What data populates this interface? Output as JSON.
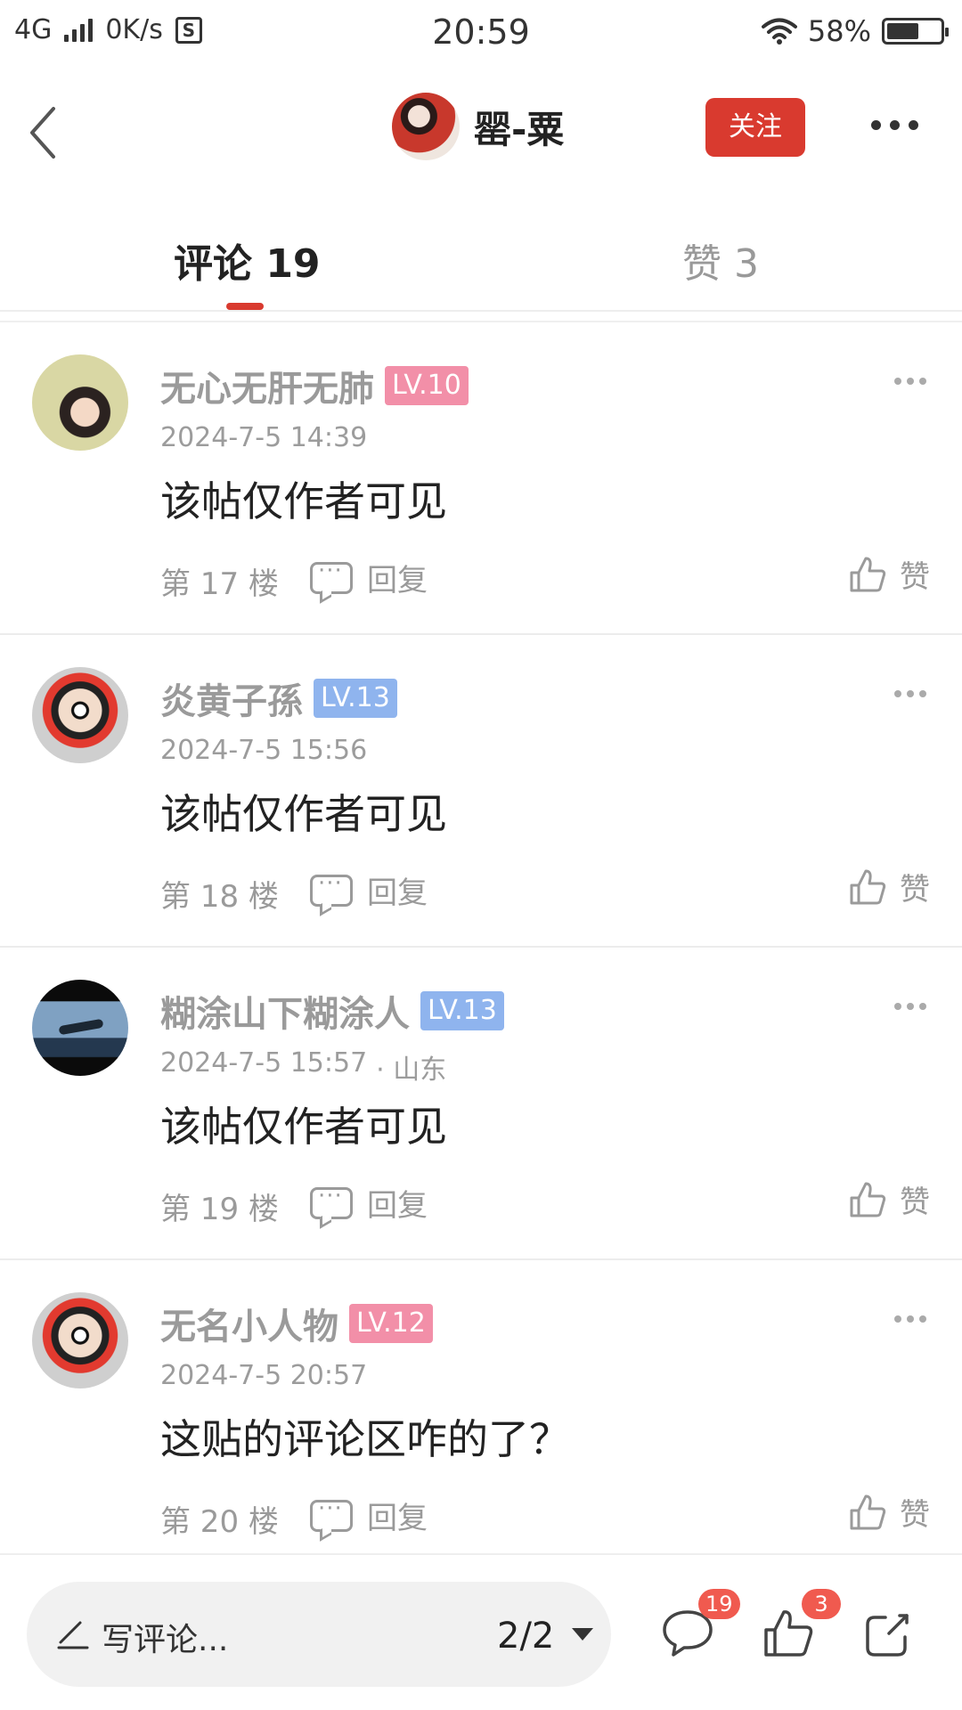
{
  "status_bar": {
    "network": "4G",
    "speed": "0K/s",
    "s_icon": "S",
    "time": "20:59",
    "battery": "58%"
  },
  "header": {
    "author_name": "罂-粟",
    "follow_label": "关注"
  },
  "tabs": {
    "comments": "评论 19",
    "likes": "赞 3"
  },
  "comments": [
    {
      "name": "无心无肝无肺",
      "level": "LV.10",
      "level_color": "#f28fa8",
      "time": "2024-7-5 14:39",
      "location": "",
      "text": "该帖仅作者可见",
      "floor": "第 17 楼",
      "reply": "回复",
      "like": "赞"
    },
    {
      "name": "炎黄子孫",
      "level": "LV.13",
      "level_color": "#8fb4ee",
      "time": "2024-7-5 15:56",
      "location": "",
      "text": "该帖仅作者可见",
      "floor": "第 18 楼",
      "reply": "回复",
      "like": "赞"
    },
    {
      "name": "糊涂山下糊涂人",
      "level": "LV.13",
      "level_color": "#8fb4ee",
      "time": "2024-7-5 15:57",
      "location": "· 山东",
      "text": "该帖仅作者可见",
      "floor": "第 19 楼",
      "reply": "回复",
      "like": "赞"
    },
    {
      "name": "无名小人物",
      "level": "LV.12",
      "level_color": "#f28fa8",
      "time": "2024-7-5 20:57",
      "location": "",
      "text": "这贴的评论区咋的了？",
      "floor": "第 20 楼",
      "reply": "回复",
      "like": "赞"
    }
  ],
  "bottom_bar": {
    "write_placeholder": "写评论...",
    "page": "2/2",
    "comment_count": "19",
    "like_count": "3"
  },
  "colors": {
    "accent": "#d93a2f",
    "badge": "#f05a4f"
  }
}
